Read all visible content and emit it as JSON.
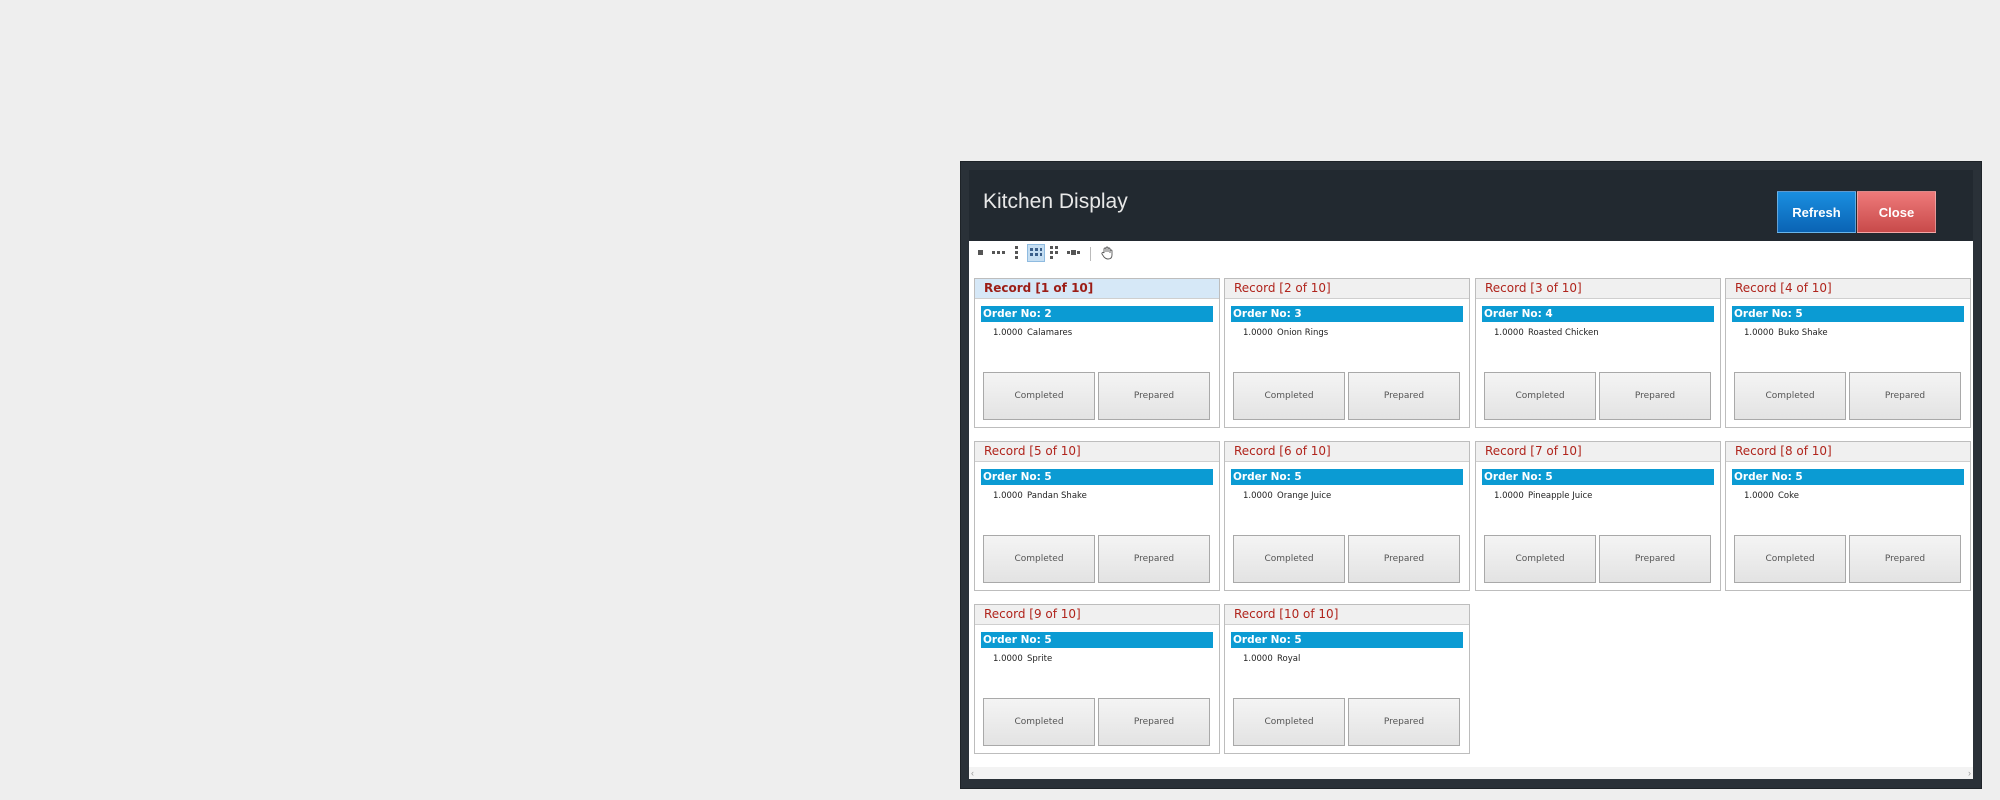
{
  "window": {
    "title": "Kitchen Display",
    "refresh_label": "Refresh",
    "close_label": "Close"
  },
  "toolbar": {
    "icons": [
      "single-view-icon",
      "horizontal-view-icon",
      "vertical-view-icon",
      "grid-view-icon",
      "multi-column-icon",
      "carousel-view-icon",
      "hand-pan-icon"
    ],
    "active": "grid-view-icon"
  },
  "cards": [
    {
      "header": "Record [1 of 10]",
      "order": "Order No: 2",
      "qty": "1.0000",
      "item": "Calamares",
      "completed": "Completed",
      "prepared": "Prepared"
    },
    {
      "header": "Record [2 of 10]",
      "order": "Order No: 3",
      "qty": "1.0000",
      "item": "Onion Rings",
      "completed": "Completed",
      "prepared": "Prepared"
    },
    {
      "header": "Record [3 of 10]",
      "order": "Order No: 4",
      "qty": "1.0000",
      "item": "Roasted Chicken",
      "completed": "Completed",
      "prepared": "Prepared"
    },
    {
      "header": "Record [4 of 10]",
      "order": "Order No: 5",
      "qty": "1.0000",
      "item": "Buko Shake",
      "completed": "Completed",
      "prepared": "Prepared"
    },
    {
      "header": "Record [5 of 10]",
      "order": "Order No: 5",
      "qty": "1.0000",
      "item": "Pandan Shake",
      "completed": "Completed",
      "prepared": "Prepared"
    },
    {
      "header": "Record [6 of 10]",
      "order": "Order No: 5",
      "qty": "1.0000",
      "item": "Orange Juice",
      "completed": "Completed",
      "prepared": "Prepared"
    },
    {
      "header": "Record [7 of 10]",
      "order": "Order No: 5",
      "qty": "1.0000",
      "item": "Pineapple Juice",
      "completed": "Completed",
      "prepared": "Prepared"
    },
    {
      "header": "Record [8 of 10]",
      "order": "Order No: 5",
      "qty": "1.0000",
      "item": "Coke",
      "completed": "Completed",
      "prepared": "Prepared"
    },
    {
      "header": "Record [9 of 10]",
      "order": "Order No: 5",
      "qty": "1.0000",
      "item": "Sprite",
      "completed": "Completed",
      "prepared": "Prepared"
    },
    {
      "header": "Record [10 of 10]",
      "order": "Order No: 5",
      "qty": "1.0000",
      "item": "Royal",
      "completed": "Completed",
      "prepared": "Prepared"
    }
  ],
  "selected_record": 1,
  "colors": {
    "order_bar": "#0b9bd3",
    "record_header_text": "#b0241c",
    "refresh_button": "#0a63b4",
    "close_button": "#d05555"
  }
}
